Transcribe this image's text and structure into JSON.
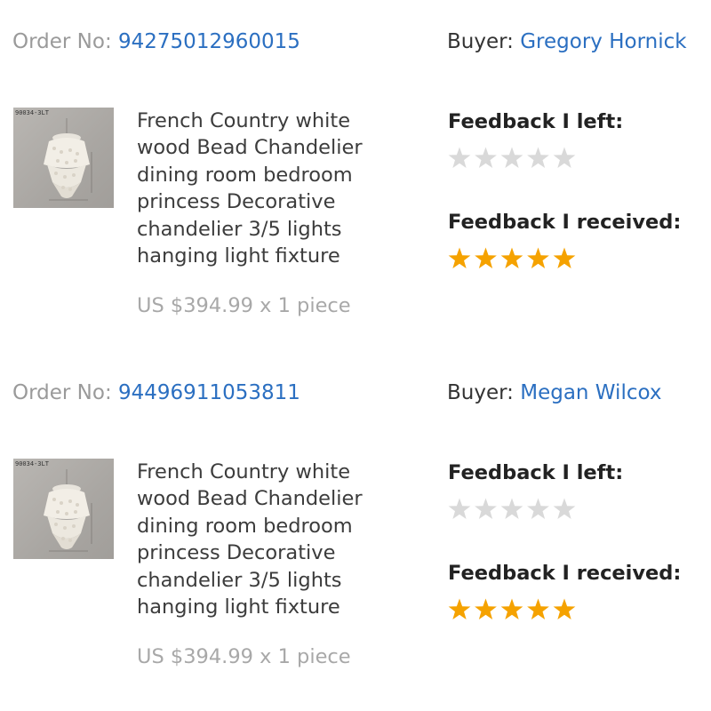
{
  "orders": [
    {
      "order_label": "Order No:",
      "order_number": "94275012960015",
      "buyer_label": "Buyer:",
      "buyer_name": "Gregory Hornick",
      "thumbnail_code": "90034-3LT",
      "product_title": "French Country white wood Bead Chandelier dining room bedroom princess Decorative chandelier 3/5 lights hanging light fixture",
      "price": "US $394.99 x 1 piece",
      "feedback_left_label": "Feedback I left:",
      "feedback_left_stars": 0,
      "feedback_received_label": "Feedback I received:",
      "feedback_received_stars": 5
    },
    {
      "order_label": "Order No:",
      "order_number": "94496911053811",
      "buyer_label": "Buyer:",
      "buyer_name": "Megan Wilcox",
      "thumbnail_code": "90034-3LT",
      "product_title": "French Country white wood Bead Chandelier dining room bedroom princess Decorative chandelier 3/5 lights hanging light fixture",
      "price": "US $394.99 x 1 piece",
      "feedback_left_label": "Feedback I left:",
      "feedback_left_stars": 0,
      "feedback_received_label": "Feedback I received:",
      "feedback_received_stars": 5
    }
  ],
  "colors": {
    "link": "#2b6fc1",
    "star_filled": "#f5a200",
    "star_empty": "#d9d9d9"
  }
}
